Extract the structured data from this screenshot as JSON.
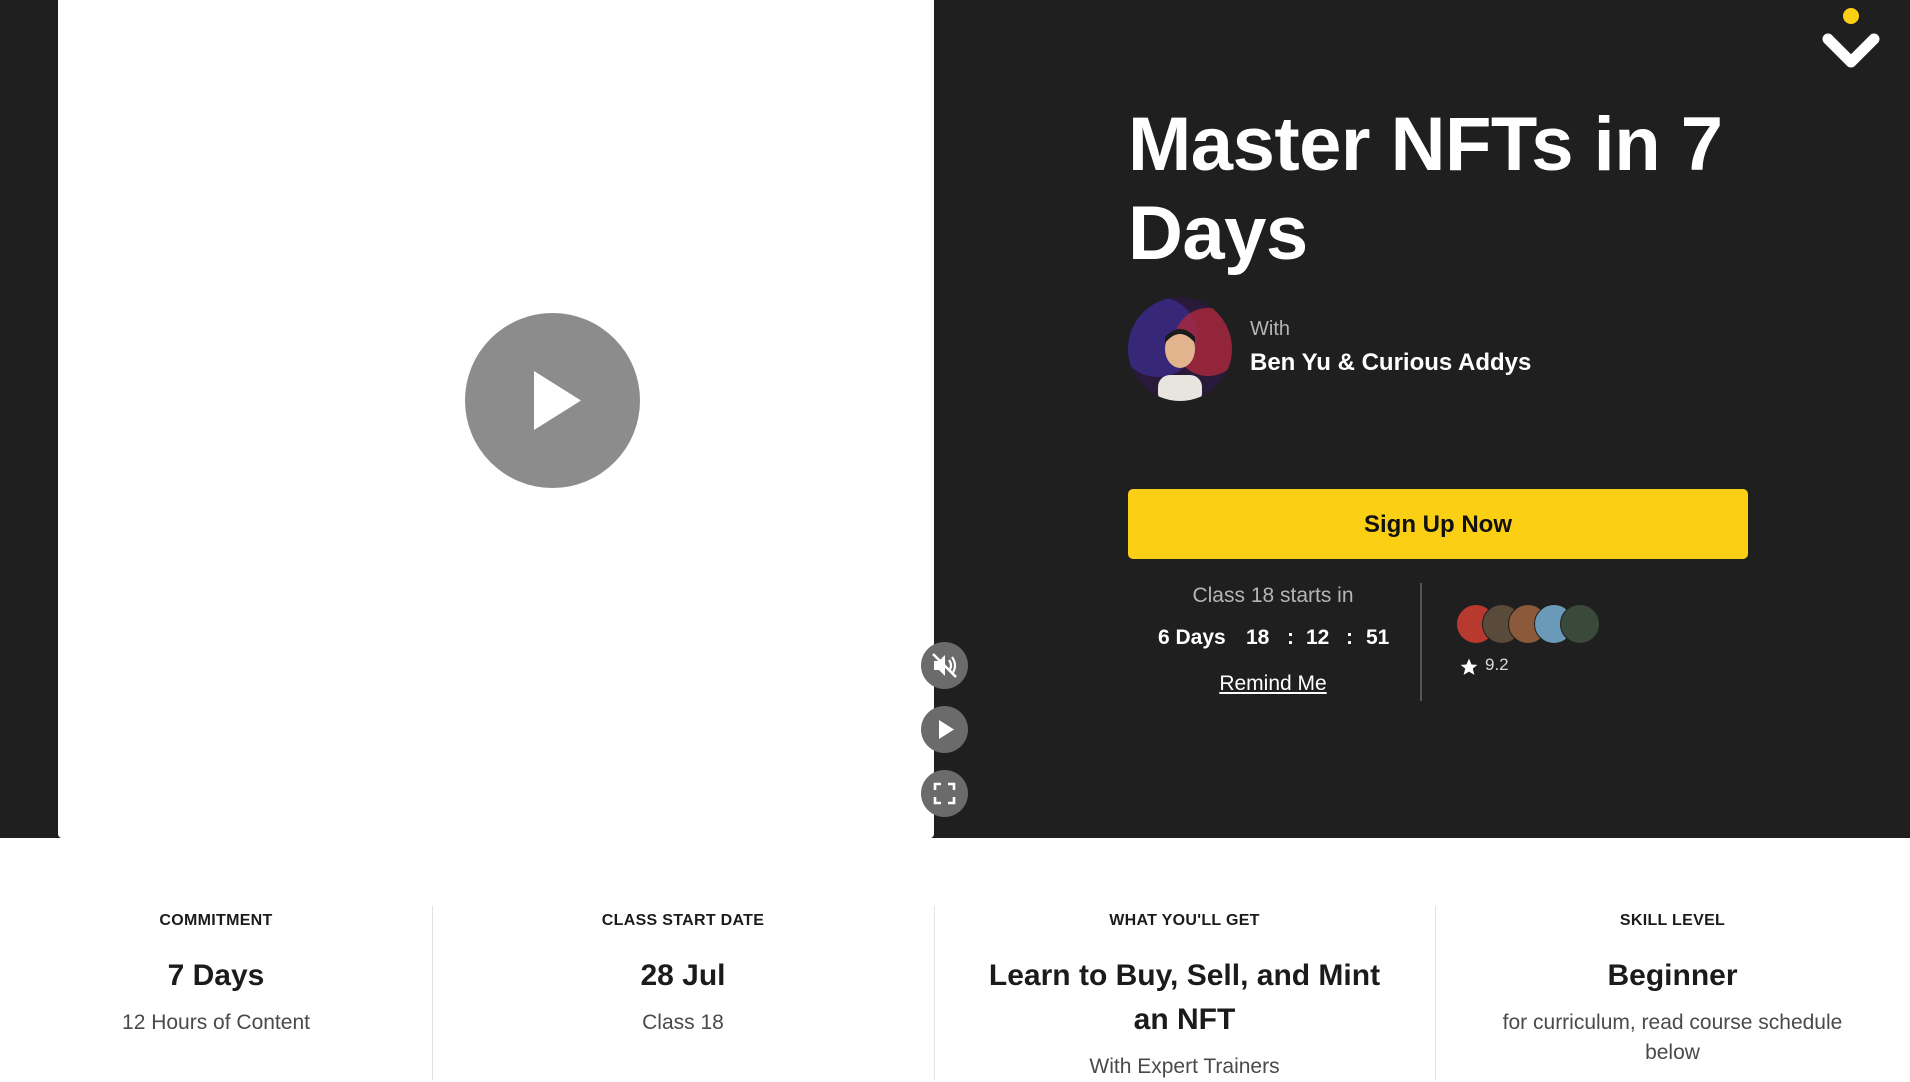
{
  "course": {
    "title": "Master NFTs in 7 Days",
    "with_label": "With",
    "instructors": "Ben Yu & Curious Addys"
  },
  "cta": {
    "signup_label": "Sign Up Now"
  },
  "schedule": {
    "starts_label": "Class 18 starts in",
    "countdown": {
      "days": "6 Days",
      "hours": "18",
      "sep1": ":",
      "minutes": "12",
      "sep2": ":",
      "seconds": "51"
    },
    "remind_label": "Remind Me"
  },
  "social": {
    "rating": "9.2"
  },
  "video": {
    "controls": [
      "big-play-icon",
      "mute-icon",
      "play-icon",
      "fullscreen-icon"
    ]
  },
  "info_cards": [
    {
      "label": "COMMITMENT",
      "main": "7 Days",
      "sub": "12 Hours of Content"
    },
    {
      "label": "CLASS START DATE",
      "main": "28 Jul",
      "sub": "Class 18"
    },
    {
      "label": "WHAT YOU'LL GET",
      "main": "Learn to Buy, Sell, and Mint an NFT",
      "sub": "With Expert Trainers"
    },
    {
      "label": "SKILL LEVEL",
      "main": "Beginner",
      "sub": "for curriculum, read course schedule below"
    }
  ],
  "colors": {
    "hero_bg": "#1f1f1f",
    "accent": "#fbcf14",
    "text_dark": "#1b1b1b"
  }
}
